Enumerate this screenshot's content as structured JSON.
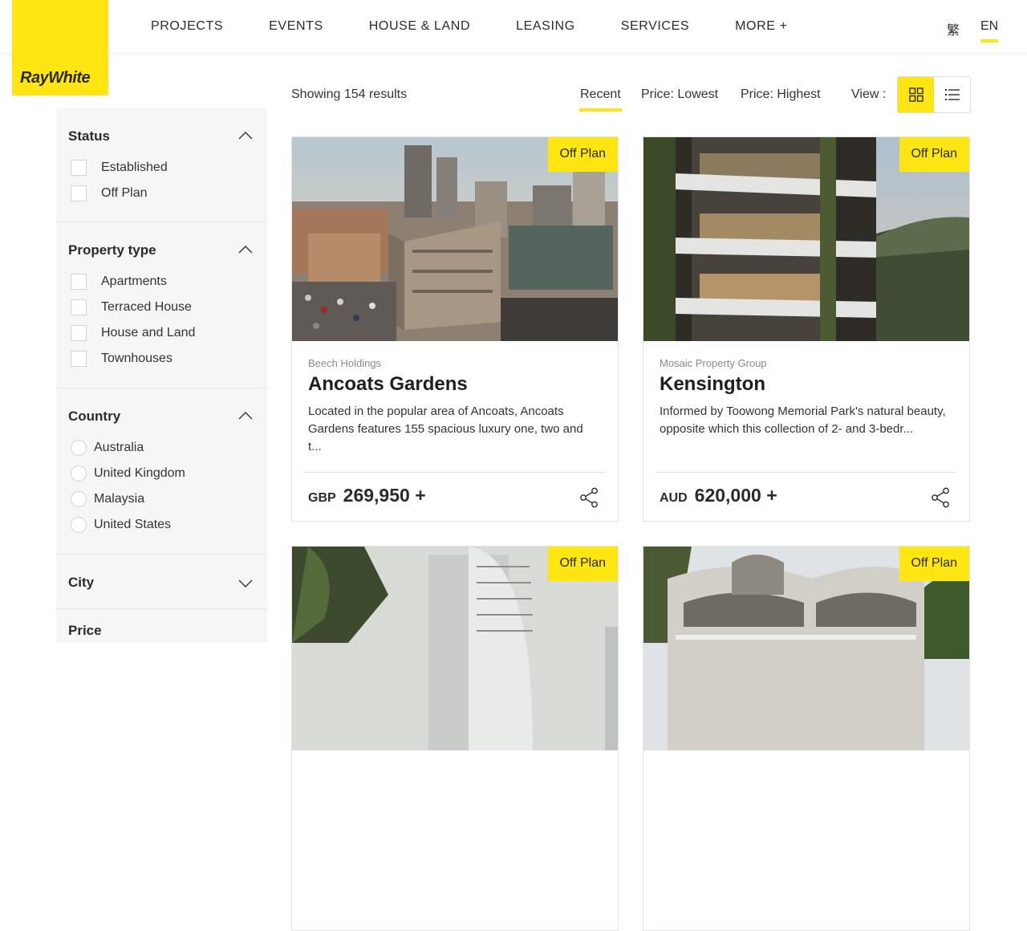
{
  "brand": {
    "name": "RayWhite",
    "color": "#ffe512"
  },
  "nav": {
    "items": [
      "PROJECTS",
      "EVENTS",
      "HOUSE & LAND",
      "LEASING",
      "SERVICES",
      "MORE +"
    ],
    "lang_zh": "繁",
    "lang_en": "EN",
    "active_lang": "EN"
  },
  "filters": {
    "status": {
      "title": "Status",
      "expanded": true,
      "options": [
        "Established",
        "Off Plan"
      ]
    },
    "property_type": {
      "title": "Property type",
      "expanded": true,
      "options": [
        "Apartments",
        "Terraced House",
        "House and Land",
        "Townhouses"
      ]
    },
    "country": {
      "title": "Country",
      "expanded": true,
      "options": [
        "Australia",
        "United Kingdom",
        "Malaysia",
        "United States"
      ]
    },
    "city": {
      "title": "City",
      "expanded": false
    },
    "price": {
      "title": "Price"
    }
  },
  "toolbar": {
    "results": "Showing 154 results",
    "sort": {
      "recent": "Recent",
      "low": "Price: Lowest",
      "high": "Price: Highest",
      "active": "Recent"
    },
    "view_label": "View :",
    "view_active": "grid"
  },
  "cards": [
    {
      "badge": "Off Plan",
      "developer": "Beech Holdings",
      "title": "Ancoats Gardens",
      "description": "Located in the popular area of Ancoats, Ancoats Gardens features 155 spacious luxury one, two and t...",
      "currency": "GBP",
      "price": "269,950 +"
    },
    {
      "badge": "Off Plan",
      "developer": "Mosaic Property Group",
      "title": "Kensington",
      "description": "Informed by Toowong Memorial Park's natural beauty, opposite which this collection of 2- and 3-bedr...",
      "currency": "AUD",
      "price": "620,000 +"
    },
    {
      "badge": "Off Plan"
    },
    {
      "badge": "Off Plan"
    }
  ],
  "icons": {
    "grid": "grid-view-icon",
    "list": "list-view-icon",
    "share": "share-icon",
    "chevron_up": "chevron-up-icon",
    "chevron_down": "chevron-down-icon"
  }
}
